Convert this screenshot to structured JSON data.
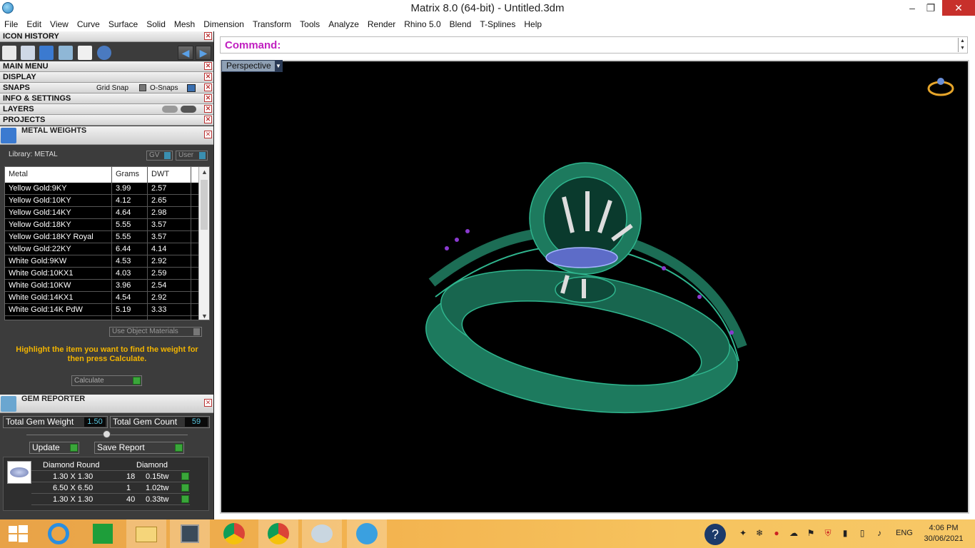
{
  "window": {
    "title": "Matrix 8.0 (64-bit) - Untitled.3dm",
    "minimize": "–",
    "restore": "❐",
    "close": "✕"
  },
  "menu": [
    "File",
    "Edit",
    "View",
    "Curve",
    "Surface",
    "Solid",
    "Mesh",
    "Dimension",
    "Transform",
    "Tools",
    "Analyze",
    "Render",
    "Rhino 5.0",
    "Blend",
    "T-Splines",
    "Help"
  ],
  "panels": {
    "icon_history": "ICON HISTORY",
    "main_menu": "MAIN MENU",
    "display": "DISPLAY",
    "snaps": "SNAPS",
    "grid_snap": "Grid Snap",
    "o_snaps": "O-Snaps",
    "info_settings": "INFO & SETTINGS",
    "layers": "LAYERS",
    "projects": "PROJECTS"
  },
  "metal_weights": {
    "title": "METAL WEIGHTS",
    "library": "Library: METAL",
    "gv": "GV",
    "user": "User",
    "columns": [
      "Metal",
      "Grams",
      "DWT"
    ],
    "rows": [
      [
        "Yellow Gold:9KY",
        "3.99",
        "2.57"
      ],
      [
        "Yellow Gold:10KY",
        "4.12",
        "2.65"
      ],
      [
        "Yellow Gold:14KY",
        "4.64",
        "2.98"
      ],
      [
        "Yellow Gold:18KY",
        "5.55",
        "3.57"
      ],
      [
        "Yellow Gold:18KY Royal",
        "5.55",
        "3.57"
      ],
      [
        "Yellow Gold:22KY",
        "6.44",
        "4.14"
      ],
      [
        "White Gold:9KW",
        "4.53",
        "2.92"
      ],
      [
        "White Gold:10KX1",
        "4.03",
        "2.59"
      ],
      [
        "White Gold:10KW",
        "3.96",
        "2.54"
      ],
      [
        "White Gold:14KX1",
        "4.54",
        "2.92"
      ],
      [
        "White Gold:14K PdW",
        "5.19",
        "3.33"
      ]
    ],
    "use_object_materials": "Use Object Materials",
    "hint": "Highlight the item you want to find the weight for then press Calculate.",
    "calculate": "Calculate"
  },
  "gem_reporter": {
    "title": "GEM REPORTER",
    "total_weight_label": "Total Gem Weight",
    "total_weight": "1.50",
    "total_count_label": "Total Gem Count",
    "total_count": "59",
    "update": "Update",
    "save_report": "Save Report",
    "columns": [
      "Diamond Round",
      "Diamond"
    ],
    "rows": [
      [
        "1.30 X 1.30",
        "18",
        "0.15tw"
      ],
      [
        "6.50 X 6.50",
        "1",
        "1.02tw"
      ],
      [
        "1.30 X 1.30",
        "40",
        "0.33tw"
      ]
    ]
  },
  "command": {
    "label": "Command:",
    "value": ""
  },
  "viewport": {
    "name": "Perspective"
  },
  "taskbar": {
    "lang": "ENG",
    "time": "4:06 PM",
    "date": "30/06/2021"
  },
  "colors": {
    "accent_command": "#c020c0",
    "hint": "#f2b400",
    "ring": "#1f8f6e"
  }
}
